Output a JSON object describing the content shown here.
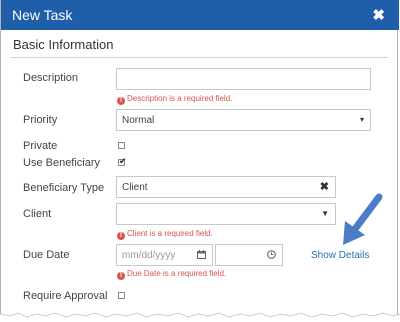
{
  "dialog": {
    "title": "New Task",
    "close_glyph": "✖",
    "section_title": "Basic Information"
  },
  "fields": {
    "description": {
      "label": "Description",
      "value": "",
      "error": "Description is a required field."
    },
    "priority": {
      "label": "Priority",
      "value": "Normal"
    },
    "private": {
      "label": "Private",
      "checked": false
    },
    "use_beneficiary": {
      "label": "Use Beneficiary",
      "checked": true
    },
    "beneficiary_type": {
      "label": "Beneficiary Type",
      "value": "Client"
    },
    "client": {
      "label": "Client",
      "value": "",
      "error": "Client is a required field."
    },
    "due_date": {
      "label": "Due Date",
      "date_placeholder": "mm/dd/yyyy",
      "time_value": "",
      "error": "Due Date is a required field."
    },
    "require_approval": {
      "label": "Require Approval",
      "checked": false
    }
  },
  "show_details_label": "Show Details",
  "error_icon": "!",
  "check_glyph": "✔",
  "icons": {
    "close": "close-icon",
    "dropdown": "caret-down-icon",
    "clear": "clear-x-icon",
    "calendar": "calendar-icon",
    "clock": "clock-icon",
    "annotation": "blue-arrow-annotation"
  },
  "colors": {
    "titlebar": "#1f5fa9",
    "error": "#d9534f",
    "link": "#2c6fb3",
    "annotation_arrow": "#4a7cc7"
  }
}
